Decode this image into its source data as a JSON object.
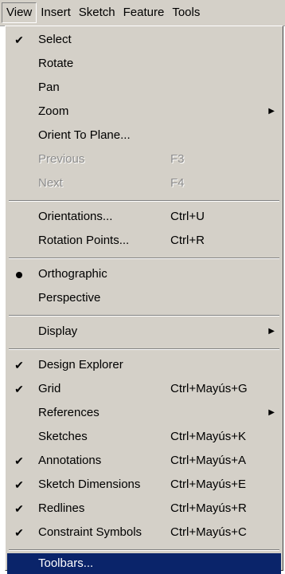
{
  "menubar": {
    "items": [
      "View",
      "Insert",
      "Sketch",
      "Feature",
      "Tools"
    ]
  },
  "menu": {
    "select": {
      "label": "Select"
    },
    "rotate": {
      "label": "Rotate"
    },
    "pan": {
      "label": "Pan"
    },
    "zoom": {
      "label": "Zoom"
    },
    "orient_to_plane": {
      "label": "Orient To Plane..."
    },
    "previous": {
      "label": "Previous",
      "shortcut": "F3"
    },
    "next": {
      "label": "Next",
      "shortcut": "F4"
    },
    "orientations": {
      "label": "Orientations...",
      "shortcut": "Ctrl+U"
    },
    "rotation_points": {
      "label": "Rotation Points...",
      "shortcut": "Ctrl+R"
    },
    "orthographic": {
      "label": "Orthographic"
    },
    "perspective": {
      "label": "Perspective"
    },
    "display": {
      "label": "Display"
    },
    "design_explorer": {
      "label": "Design Explorer"
    },
    "grid": {
      "label": "Grid",
      "shortcut": "Ctrl+Mayús+G"
    },
    "references": {
      "label": "References"
    },
    "sketches": {
      "label": "Sketches",
      "shortcut": "Ctrl+Mayús+K"
    },
    "annotations": {
      "label": "Annotations",
      "shortcut": "Ctrl+Mayús+A"
    },
    "sketch_dimensions": {
      "label": "Sketch Dimensions",
      "shortcut": "Ctrl+Mayús+E"
    },
    "redlines": {
      "label": "Redlines",
      "shortcut": "Ctrl+Mayús+R"
    },
    "constraint_symbols": {
      "label": "Constraint Symbols",
      "shortcut": "Ctrl+Mayús+C"
    },
    "toolbars": {
      "label": "Toolbars..."
    }
  },
  "glyphs": {
    "check": "✔",
    "submenu": "▶"
  }
}
